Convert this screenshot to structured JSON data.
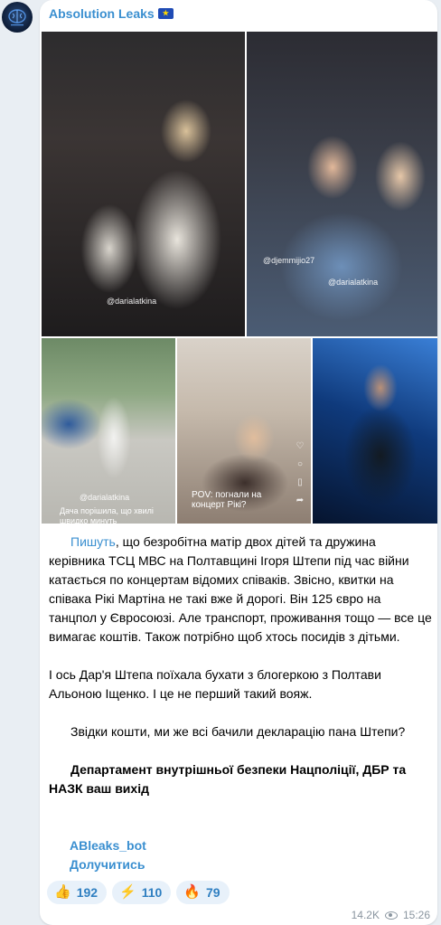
{
  "channel": {
    "name": "Absolution Leaks",
    "flag_icon": "eu-flag-icon"
  },
  "photos": [
    {
      "id": "photo-1",
      "tag": "@darialatkina"
    },
    {
      "id": "photo-2",
      "tags": [
        "@djemmijio27",
        "@darialatkina"
      ]
    },
    {
      "id": "photo-3",
      "tag": "@darialatkina",
      "caption": "Дача порішила, що хвилі швидко минуть"
    },
    {
      "id": "photo-4",
      "caption": "POV: погнали на концерт Рікі?"
    },
    {
      "id": "photo-5"
    }
  ],
  "post": {
    "link_word": "Пишуть",
    "paragraph1_rest": ", що безробітна матір двох дітей та дружина керівника ТСЦ МВС на Полтавщині Ігоря Штепи під час війни катається по концертам відомих співаків. Звісно, квитки на співака Рікі Мартіна не такі вже й дорогі. Він 125 євро на танцпол у Євросоюзі. Але транспорт, проживання тощо — все це вимагає коштів. Також потрібно щоб хтось посидів з дітьми.",
    "paragraph2": "І ось Дар'я Штепа поїхала бухати з блогеркою з Полтави Альоною Іщенко. І це не перший такий вояж.",
    "paragraph3": "Звідки кошти, ми же всі бачили декларацію пана Штепи?",
    "paragraph4": "Департамент внутрішньої безпеки Нацполіції, ДБР та НАЗК ваш вихід",
    "bot_link": "ABleaks_bot",
    "join_link": "Долучитись"
  },
  "reactions": [
    {
      "emoji": "👍",
      "count": "192"
    },
    {
      "emoji": "⚡",
      "count": "110"
    },
    {
      "emoji": "🔥",
      "count": "79"
    }
  ],
  "meta": {
    "views": "14.2K",
    "time": "15:26"
  }
}
